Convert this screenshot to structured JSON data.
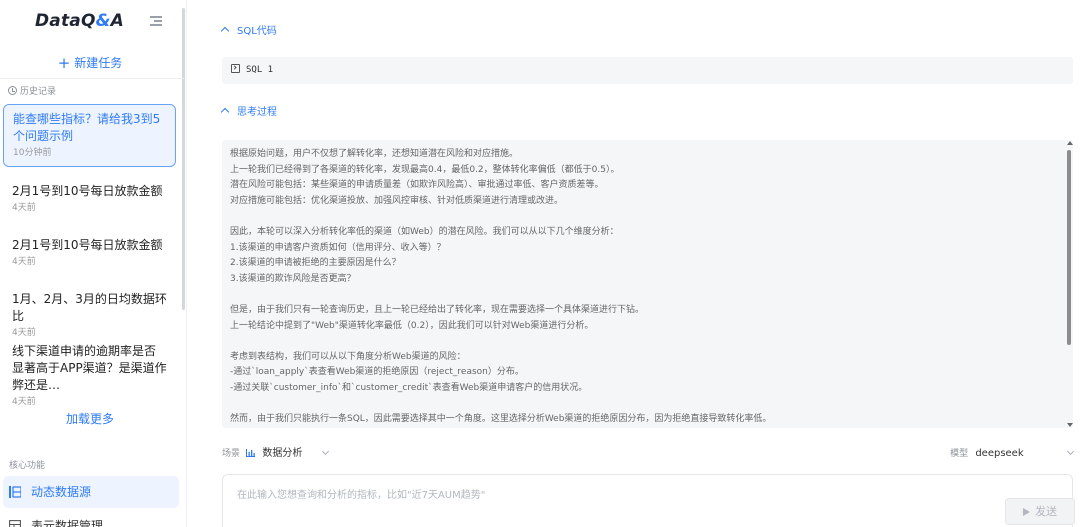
{
  "app": {
    "logo_text": "DataQ",
    "logo_amp": "&",
    "logo_tail": "A"
  },
  "sidebar": {
    "new_task_label": "新建任务",
    "history_label": "历史记录",
    "history": [
      {
        "title": "能查哪些指标？请给我3到5个问题示例",
        "time": "10分钟前",
        "active": true
      },
      {
        "title": "2月1号到10号每日放款金额",
        "time": "4天前"
      },
      {
        "title": "2月1号到10号每日放款金额",
        "time": "4天前"
      },
      {
        "title": "1月、2月、3月的日均数据环比",
        "time": "4天前"
      },
      {
        "title": "线下渠道申请的逾期率是否显著高于APP渠道？是渠道作弊还是…",
        "time": "4天前"
      }
    ],
    "load_more_label": "加载更多",
    "core_label": "核心功能",
    "menu": [
      {
        "label": "动态数据源",
        "icon": "database-icon"
      },
      {
        "label": "表元数据管理",
        "icon": "table-icon"
      }
    ]
  },
  "main": {
    "sql_section": {
      "title": "SQL代码",
      "item": "SQL 1"
    },
    "thinking_section": {
      "title": "思考过程",
      "lines": [
        "根据原始问题，用户不仅想了解转化率，还想知道潜在风险和对应措施。",
        "上一轮我们已经得到了各渠道的转化率，发现最高0.4，最低0.2，整体转化率偏低（都低于0.5）。",
        "潜在风险可能包括：某些渠道的申请质量差（如欺诈风险高）、审批通过率低、客户资质差等。",
        "对应措施可能包括：优化渠道投放、加强风控审核、针对低质渠道进行清理或改进。",
        "",
        "因此，本轮可以深入分析转化率低的渠道（如Web）的潜在风险。我们可以从以下几个维度分析：",
        "1.该渠道的申请客户资质如何（信用评分、收入等）？",
        "2.该渠道的申请被拒绝的主要原因是什么？",
        "3.该渠道的欺诈风险是否更高？",
        "",
        "但是，由于我们只有一轮查询历史，且上一轮已经给出了转化率，现在需要选择一个具体渠道进行下钻。",
        "上一轮结论中提到了\"Web\"渠道转化率最低（0.2），因此我们可以针对Web渠道进行分析。",
        "",
        "考虑到表结构，我们可以从以下角度分析Web渠道的风险：",
        " -通过`loan_apply`表查看Web渠道的拒绝原因（reject_reason）分布。",
        " -通过关联`customer_info`和`customer_credit`表查看Web渠道申请客户的信用状况。",
        "",
        "然而，由于我们只能执行一条SQL，因此需要选择其中一个角度。这里选择分析Web渠道的拒绝原因分布，因为拒绝直接导致转化率低。"
      ]
    },
    "scene": {
      "label": "场景",
      "value": "数据分析"
    },
    "model": {
      "label": "模型",
      "value": "deepseek"
    },
    "input": {
      "placeholder": "在此输入您想查询和分析的指标，比如\"近7天AUM趋势\"",
      "value": ""
    },
    "send_label": "发送"
  }
}
